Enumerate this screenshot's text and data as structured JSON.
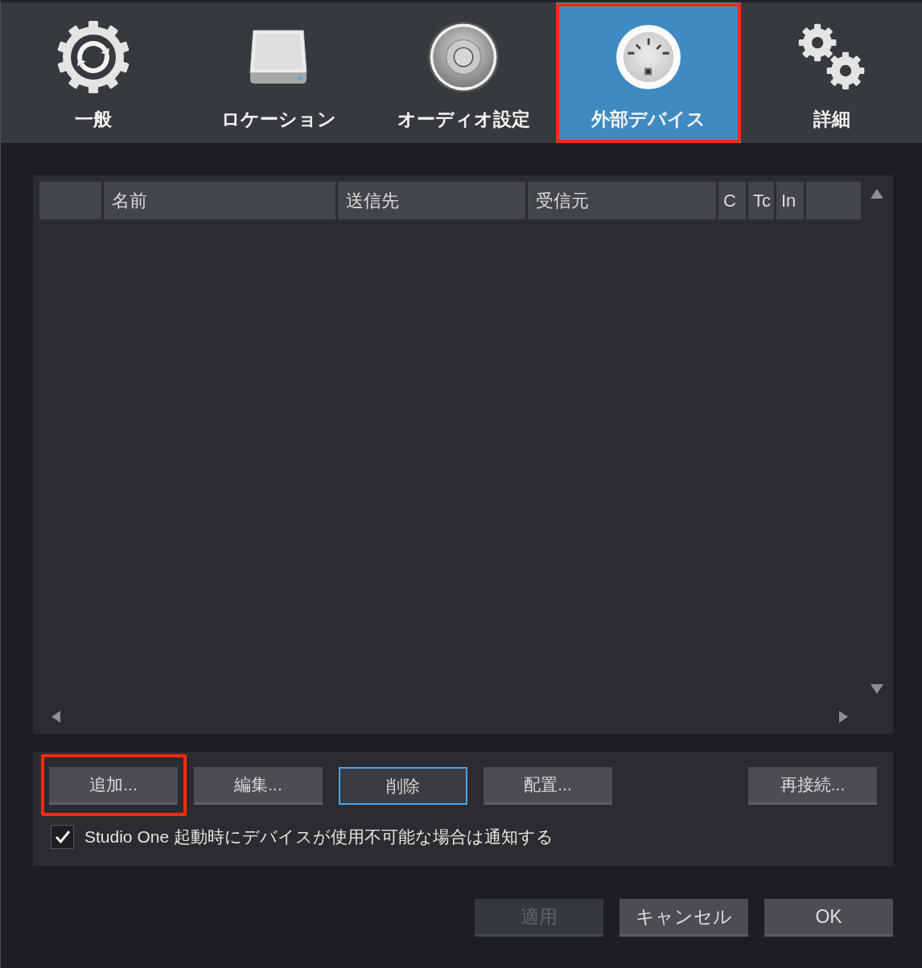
{
  "tabs": [
    {
      "label": "一般",
      "selected": false,
      "highlighted": false
    },
    {
      "label": "ロケーション",
      "selected": false,
      "highlighted": false
    },
    {
      "label": "オーディオ設定",
      "selected": false,
      "highlighted": false
    },
    {
      "label": "外部デバイス",
      "selected": true,
      "highlighted": true
    },
    {
      "label": "詳細",
      "selected": false,
      "highlighted": false
    }
  ],
  "device_table": {
    "columns": [
      {
        "label": "名前"
      },
      {
        "label": "送信先"
      },
      {
        "label": "受信元"
      },
      {
        "label": "C"
      },
      {
        "label": "Tc"
      },
      {
        "label": "In"
      }
    ]
  },
  "device_buttons": [
    {
      "label": "追加...",
      "focused": false,
      "highlighted": true
    },
    {
      "label": "編集...",
      "focused": false,
      "highlighted": false
    },
    {
      "label": "削除",
      "focused": true,
      "highlighted": false
    },
    {
      "label": "配置...",
      "focused": false,
      "highlighted": false
    },
    {
      "label": "再接続...",
      "focused": false,
      "highlighted": false
    }
  ],
  "notify_option": {
    "label": "Studio One 起動時にデバイスが使用不可能な場合は通知する",
    "checked": true
  },
  "dialog_buttons": [
    {
      "label": "適用",
      "disabled": true
    },
    {
      "label": "キャンセル",
      "disabled": false
    },
    {
      "label": "OK",
      "disabled": false
    }
  ]
}
